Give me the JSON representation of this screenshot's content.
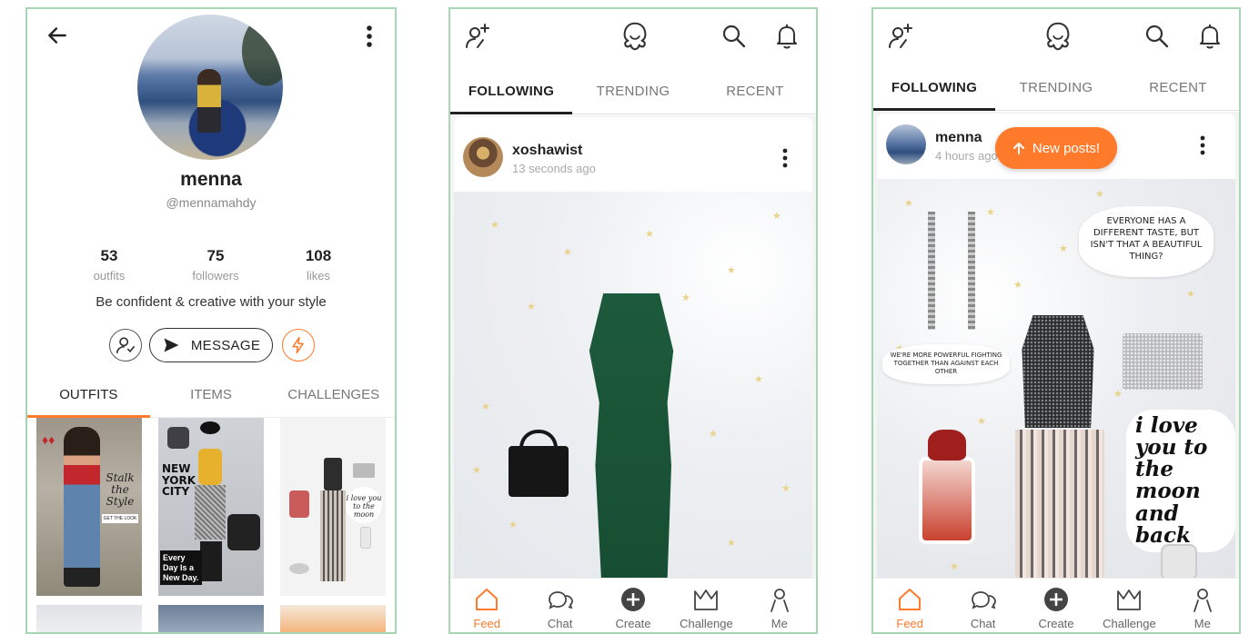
{
  "profile": {
    "name": "menna",
    "handle": "@mennamahdy",
    "stats": [
      {
        "value": "53",
        "label": "outfits"
      },
      {
        "value": "75",
        "label": "followers"
      },
      {
        "value": "108",
        "label": "likes"
      }
    ],
    "bio": "Be confident & creative with your style",
    "message_label": "MESSAGE",
    "tabs": [
      "OUTFITS",
      "ITEMS",
      "CHALLENGES"
    ],
    "tile_texts": {
      "t1": "Stalk the Style",
      "t1b": "GET THE LOOK",
      "t2": "NEW YORK CITY",
      "t2b": "Every Day Is a New Day."
    }
  },
  "feed": {
    "tabs": [
      "FOLLOWING",
      "TRENDING",
      "RECENT"
    ],
    "post1": {
      "user": "xoshawist",
      "time": "13 seconds ago"
    },
    "post2": {
      "user": "menna",
      "time": "4 hours ago",
      "quote1": "EVERYONE HAS A DIFFERENT TASTE, BUT ISN'T THAT A BEAUTIFUL THING?",
      "quote2": "WE'RE MORE POWERFUL FIGHTING TOGETHER THAN AGAINST EACH OTHER",
      "script": "i love you to the moon and back"
    },
    "new_posts_label": "New posts!",
    "nav": [
      "Feed",
      "Chat",
      "Create",
      "Challenge",
      "Me"
    ]
  },
  "colors": {
    "accent": "#ff7a2b",
    "frame": "#a8d5b4"
  }
}
